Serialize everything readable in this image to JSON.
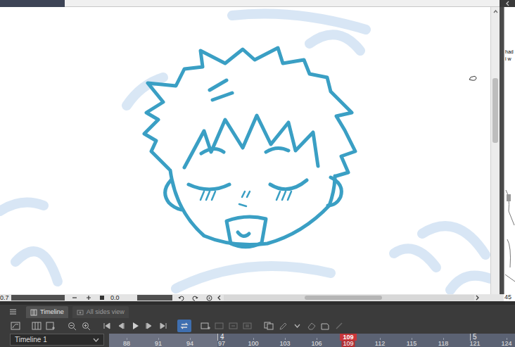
{
  "canvas": {
    "zoom": "0.7",
    "rotation": "0.0"
  },
  "side_canvas": {
    "texts": [
      "had",
      "i w"
    ],
    "page_number": "45"
  },
  "timeline": {
    "tabs": [
      {
        "label": "Timeline",
        "selected": true
      },
      {
        "label": "All sides view",
        "selected": false
      }
    ],
    "loop_on": true,
    "timeline_name": "Timeline 1",
    "current_frame": "109",
    "markers": [
      {
        "label": "4"
      },
      {
        "label": "5"
      }
    ],
    "frames": [
      {
        "label": "88",
        "current": false
      },
      {
        "label": "91",
        "current": false
      },
      {
        "label": "94",
        "current": false
      },
      {
        "label": "97",
        "current": false
      },
      {
        "label": "100",
        "current": false
      },
      {
        "label": "103",
        "current": false
      },
      {
        "label": "106",
        "current": false
      },
      {
        "label": "109",
        "current": true
      },
      {
        "label": "112",
        "current": false
      },
      {
        "label": "115",
        "current": false
      },
      {
        "label": "118",
        "current": false
      },
      {
        "label": "121",
        "current": false
      },
      {
        "label": "124",
        "current": false
      }
    ]
  }
}
